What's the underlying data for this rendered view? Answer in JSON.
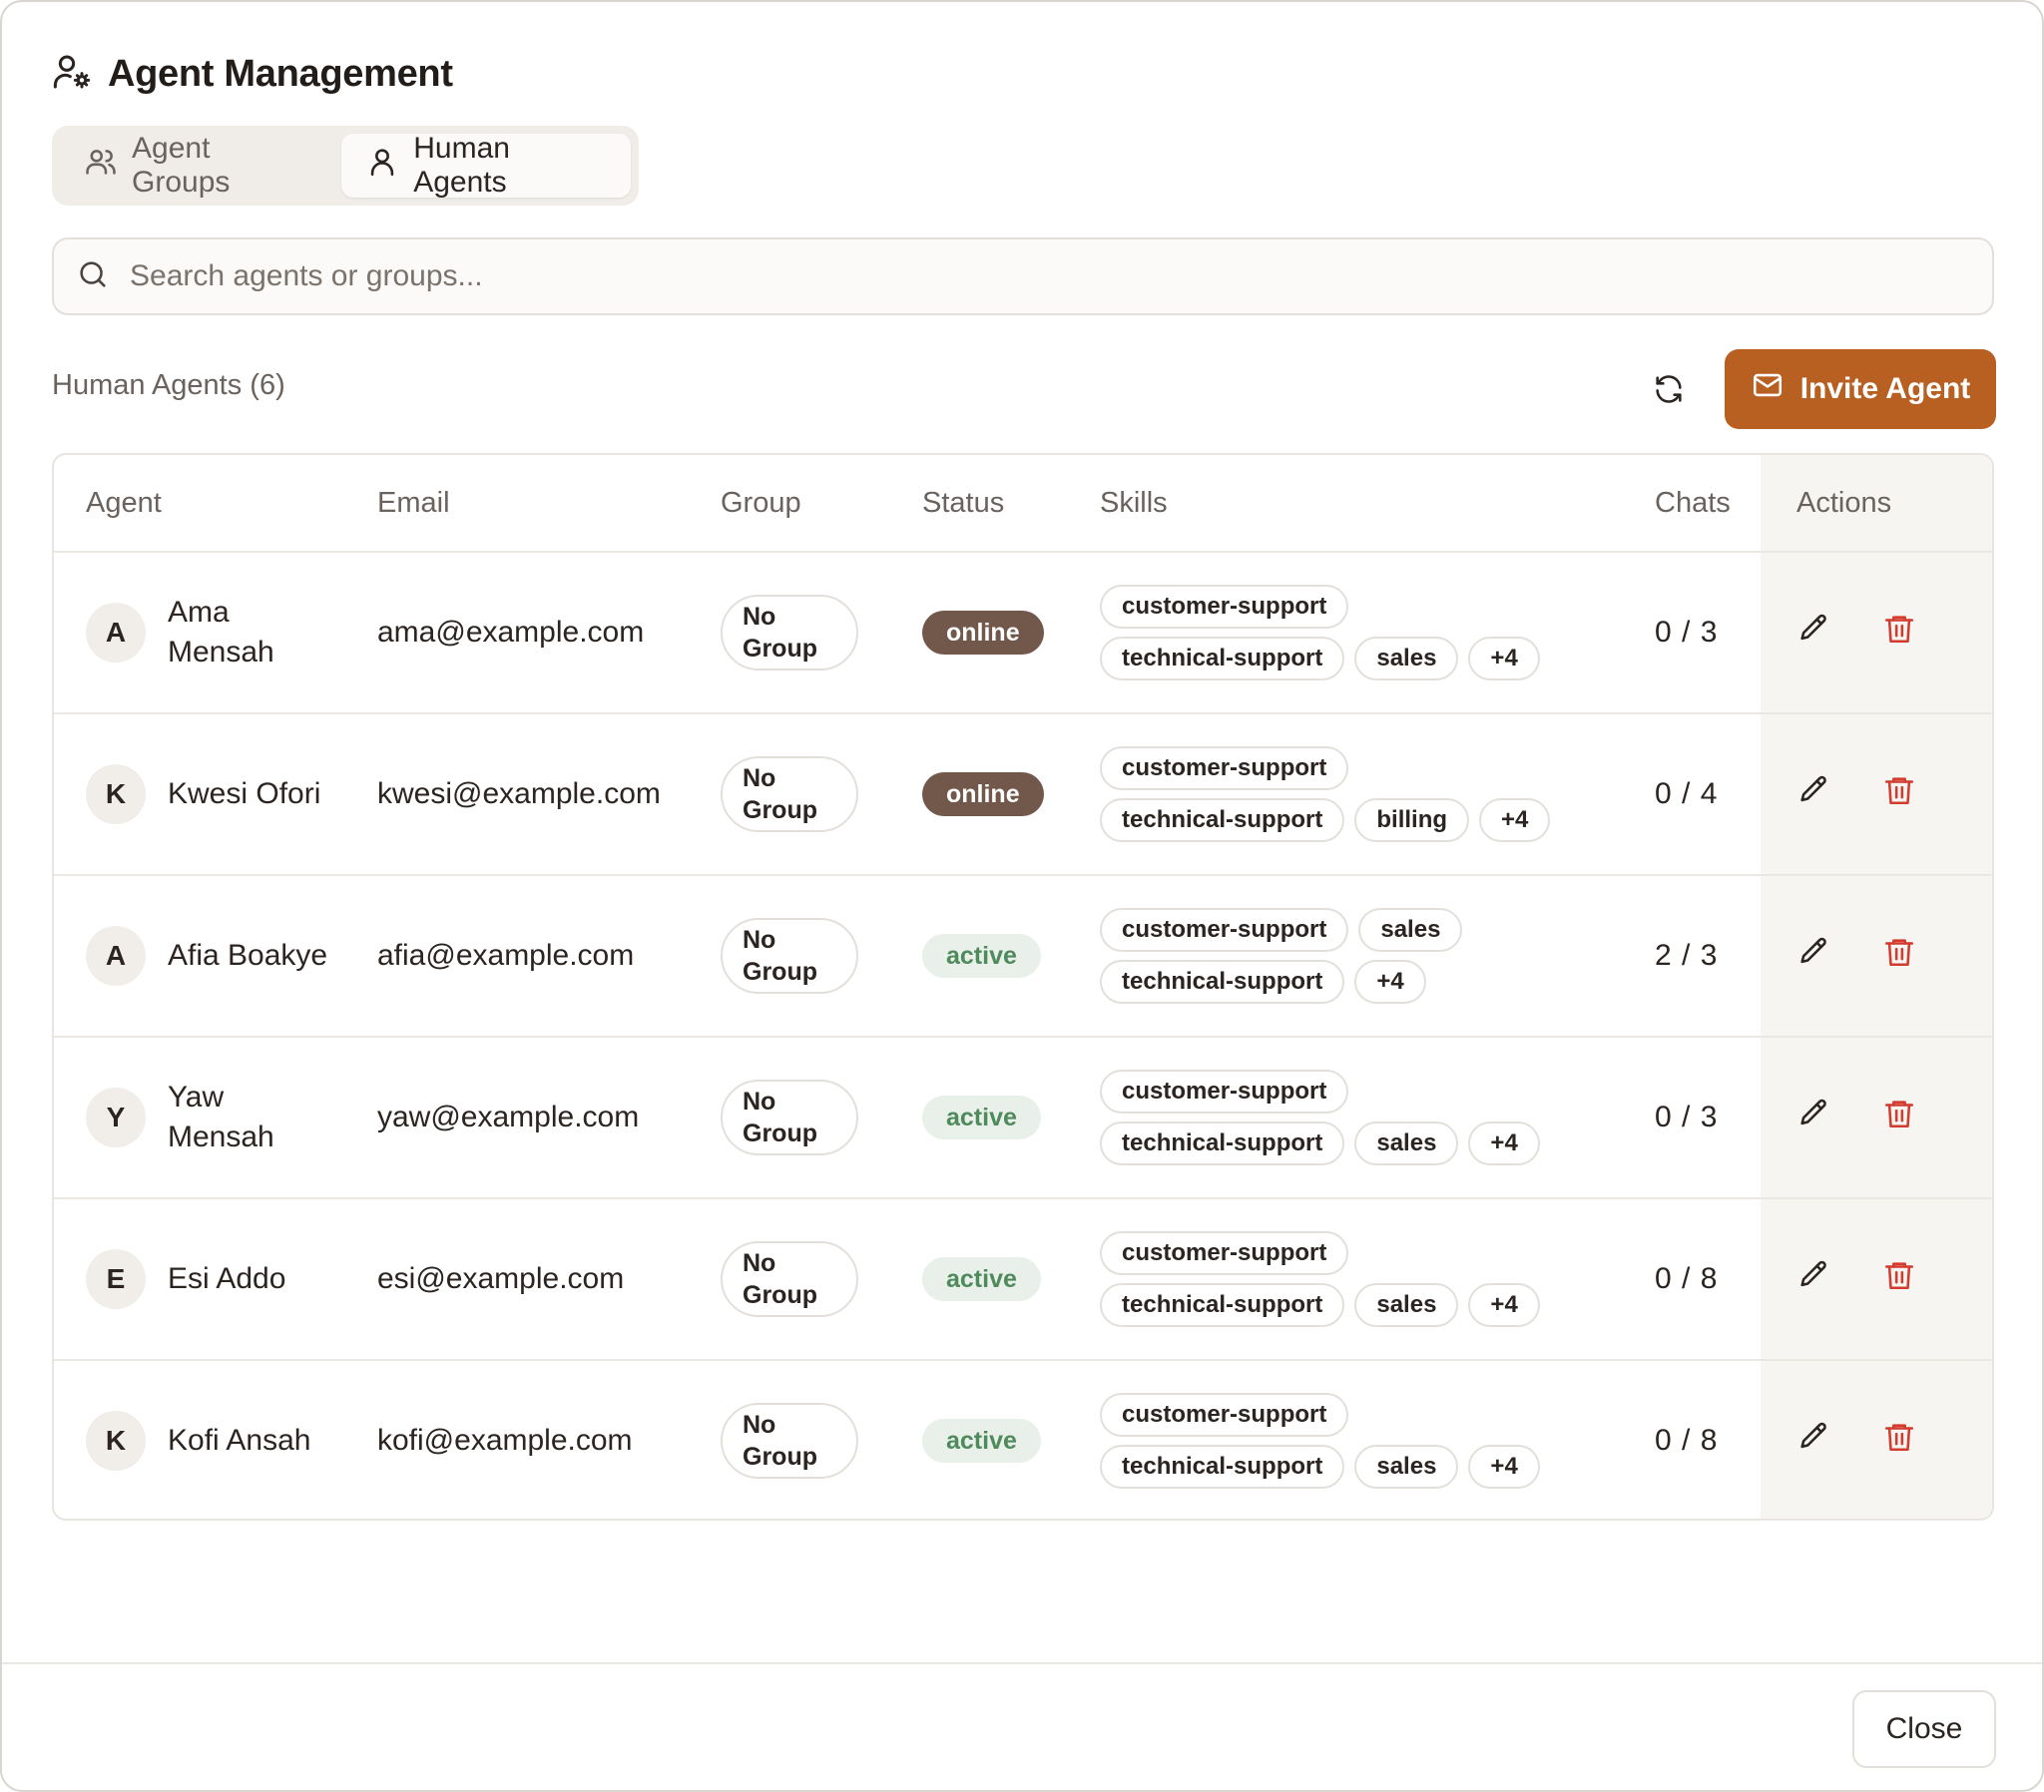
{
  "dialog": {
    "title": "Agent Management",
    "title_icon": "user-gear-icon",
    "tabs": [
      {
        "label": "Agent Groups",
        "icon": "users-icon",
        "active": false
      },
      {
        "label": "Human Agents",
        "icon": "user-icon",
        "active": true
      }
    ],
    "search": {
      "placeholder": "Search agents or groups...",
      "value": ""
    },
    "section": {
      "count_label": "Human Agents (6)",
      "invite_label": "Invite Agent"
    },
    "colors": {
      "accent": "#b85f22",
      "online": "#72584a",
      "active_bg": "#e8f0e9",
      "active_text": "#4f8a5d",
      "delete": "#d23b2e"
    },
    "table": {
      "headers": {
        "agent": "Agent",
        "email": "Email",
        "group": "Group",
        "status": "Status",
        "skills": "Skills",
        "chats": "Chats",
        "actions": "Actions"
      },
      "rows": [
        {
          "initial": "A",
          "name": "Ama Mensah",
          "email": "ama@example.com",
          "group": "No Group",
          "status": "online",
          "skills_line1": [
            "customer-support"
          ],
          "skills_line2": [
            "technical-support",
            "sales",
            "+4"
          ],
          "chats": "0 / 3"
        },
        {
          "initial": "K",
          "name": "Kwesi Ofori",
          "email": "kwesi@example.com",
          "group": "No Group",
          "status": "online",
          "skills_line1": [
            "customer-support"
          ],
          "skills_line2": [
            "technical-support",
            "billing",
            "+4"
          ],
          "chats": "0 / 4"
        },
        {
          "initial": "A",
          "name": "Afia Boakye",
          "email": "afia@example.com",
          "group": "No Group",
          "status": "active",
          "skills_line1": [
            "customer-support",
            "sales"
          ],
          "skills_line2": [
            "technical-support",
            "+4"
          ],
          "chats": "2 / 3"
        },
        {
          "initial": "Y",
          "name": "Yaw Mensah",
          "email": "yaw@example.com",
          "group": "No Group",
          "status": "active",
          "skills_line1": [
            "customer-support"
          ],
          "skills_line2": [
            "technical-support",
            "sales",
            "+4"
          ],
          "chats": "0 / 3"
        },
        {
          "initial": "E",
          "name": "Esi Addo",
          "email": "esi@example.com",
          "group": "No Group",
          "status": "active",
          "skills_line1": [
            "customer-support"
          ],
          "skills_line2": [
            "technical-support",
            "sales",
            "+4"
          ],
          "chats": "0 / 8"
        },
        {
          "initial": "K",
          "name": "Kofi Ansah",
          "email": "kofi@example.com",
          "group": "No Group",
          "status": "active",
          "skills_line1": [
            "customer-support"
          ],
          "skills_line2": [
            "technical-support",
            "sales",
            "+4"
          ],
          "chats": "0 / 8"
        }
      ]
    },
    "footer": {
      "close_label": "Close"
    }
  }
}
